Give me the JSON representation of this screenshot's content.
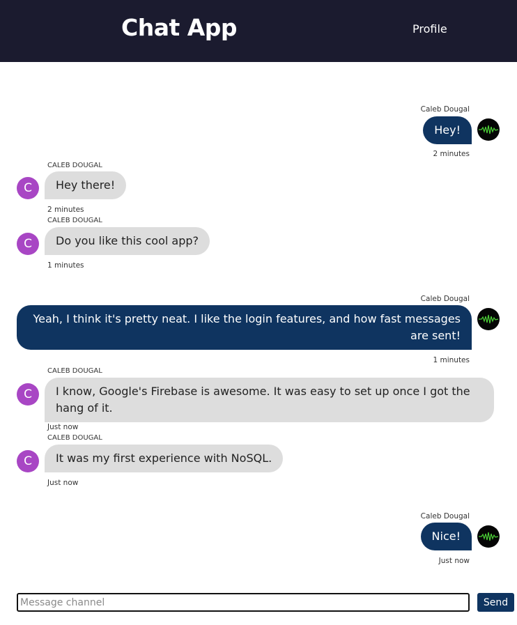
{
  "header": {
    "title": "Chat App",
    "profile_link": "Profile"
  },
  "messages": [
    {
      "side": "sent",
      "author": "Caleb Dougal",
      "text": "Hey!",
      "time": "2 minutes",
      "avatar": "waveform-icon"
    },
    {
      "side": "received",
      "author": "CALEB DOUGAL",
      "text": "Hey there!",
      "time": "2 minutes",
      "avatar_letter": "C"
    },
    {
      "side": "received",
      "author": "CALEB DOUGAL",
      "text": "Do you like this cool app?",
      "time": "1 minutes",
      "avatar_letter": "C"
    },
    {
      "side": "sent",
      "author": "Caleb Dougal",
      "text": "Yeah, I think it's pretty neat. I like the login features, and how fast messages are sent!",
      "time": "1 minutes",
      "avatar": "waveform-icon"
    },
    {
      "side": "received",
      "author": "CALEB DOUGAL",
      "text": "I know, Google's Firebase is awesome. It was easy to set up once I got the hang of it.",
      "time": "Just now",
      "avatar_letter": "C"
    },
    {
      "side": "received",
      "author": "CALEB DOUGAL",
      "text": "It was my first experience with NoSQL.",
      "time": "Just now",
      "avatar_letter": "C"
    },
    {
      "side": "sent",
      "author": "Caleb Dougal",
      "text": "Nice!",
      "time": "Just now",
      "avatar": "waveform-icon"
    }
  ],
  "composer": {
    "placeholder": "Message channel",
    "value": "",
    "send_label": "Send"
  },
  "colors": {
    "header_bg": "#1b1b2f",
    "sent_bubble": "#0f3460",
    "received_bubble": "#dddddd",
    "avatar_letter_bg": "#a846c4",
    "waveform": "#4cd137"
  }
}
